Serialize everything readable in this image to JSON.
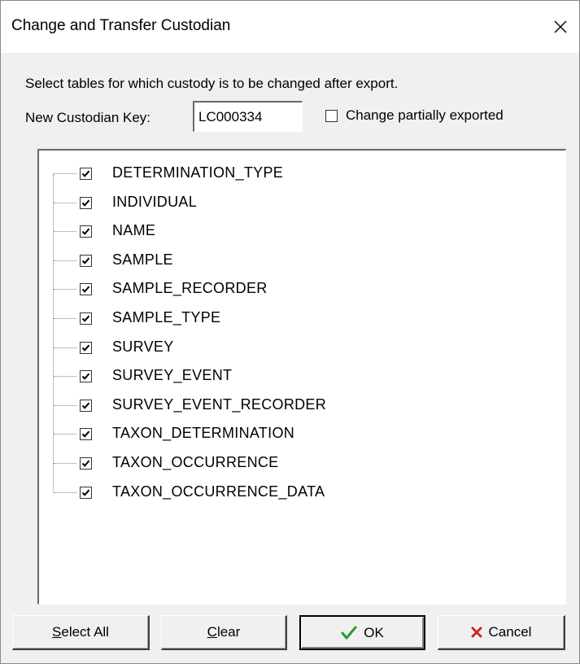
{
  "window": {
    "title": "Change and Transfer Custodian"
  },
  "instruction": "Select tables for which custody is to be changed after export.",
  "custodian": {
    "label": "New Custodian Key:",
    "value": "LC000334"
  },
  "partial": {
    "label": "Change partially exported",
    "checked": false
  },
  "tables": [
    {
      "name": "DETERMINATION_TYPE",
      "checked": true
    },
    {
      "name": "INDIVIDUAL",
      "checked": true
    },
    {
      "name": "NAME",
      "checked": true
    },
    {
      "name": "SAMPLE",
      "checked": true
    },
    {
      "name": "SAMPLE_RECORDER",
      "checked": true
    },
    {
      "name": "SAMPLE_TYPE",
      "checked": true
    },
    {
      "name": "SURVEY",
      "checked": true
    },
    {
      "name": "SURVEY_EVENT",
      "checked": true
    },
    {
      "name": "SURVEY_EVENT_RECORDER",
      "checked": true
    },
    {
      "name": "TAXON_DETERMINATION",
      "checked": true
    },
    {
      "name": "TAXON_OCCURRENCE",
      "checked": true
    },
    {
      "name": "TAXON_OCCURRENCE_DATA",
      "checked": true
    }
  ],
  "buttons": {
    "select_all": {
      "accel": "S",
      "rest": "elect All"
    },
    "clear": {
      "accel": "C",
      "rest": "lear"
    },
    "ok": {
      "label": "OK",
      "icon": "checkmark-icon",
      "icon_color": "#2e9b2e"
    },
    "cancel": {
      "label": "Cancel",
      "icon": "cross-icon",
      "icon_color": "#c8281e"
    }
  }
}
